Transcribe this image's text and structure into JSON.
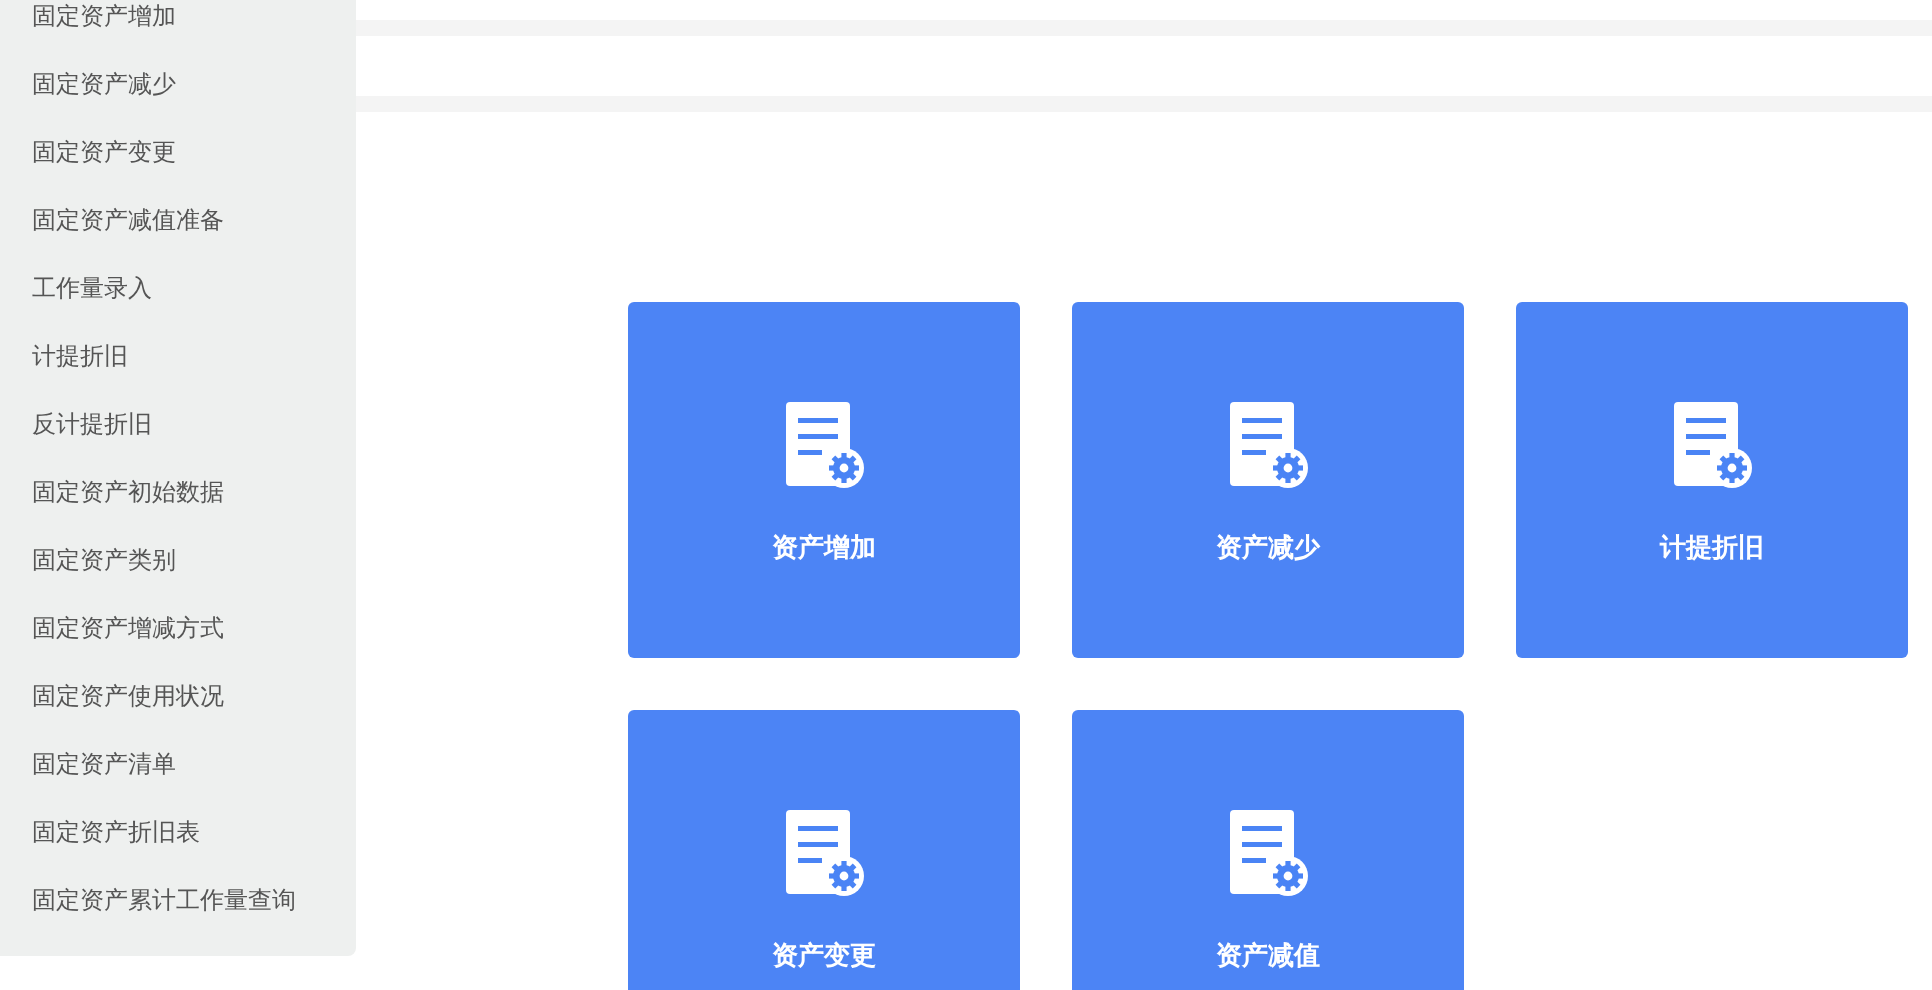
{
  "sidebar": {
    "items": [
      {
        "label": "固定资产增加"
      },
      {
        "label": "固定资产减少"
      },
      {
        "label": "固定资产变更"
      },
      {
        "label": "固定资产减值准备"
      },
      {
        "label": "工作量录入"
      },
      {
        "label": "计提折旧"
      },
      {
        "label": "反计提折旧"
      },
      {
        "label": "固定资产初始数据"
      },
      {
        "label": "固定资产类别"
      },
      {
        "label": "固定资产增减方式"
      },
      {
        "label": "固定资产使用状况"
      },
      {
        "label": "固定资产清单"
      },
      {
        "label": "固定资产折旧表"
      },
      {
        "label": "固定资产累计工作量查询"
      }
    ]
  },
  "tiles": [
    {
      "label": "资产增加"
    },
    {
      "label": "资产减少"
    },
    {
      "label": "计提折旧"
    },
    {
      "label": "资产变更"
    },
    {
      "label": "资产减值"
    }
  ]
}
